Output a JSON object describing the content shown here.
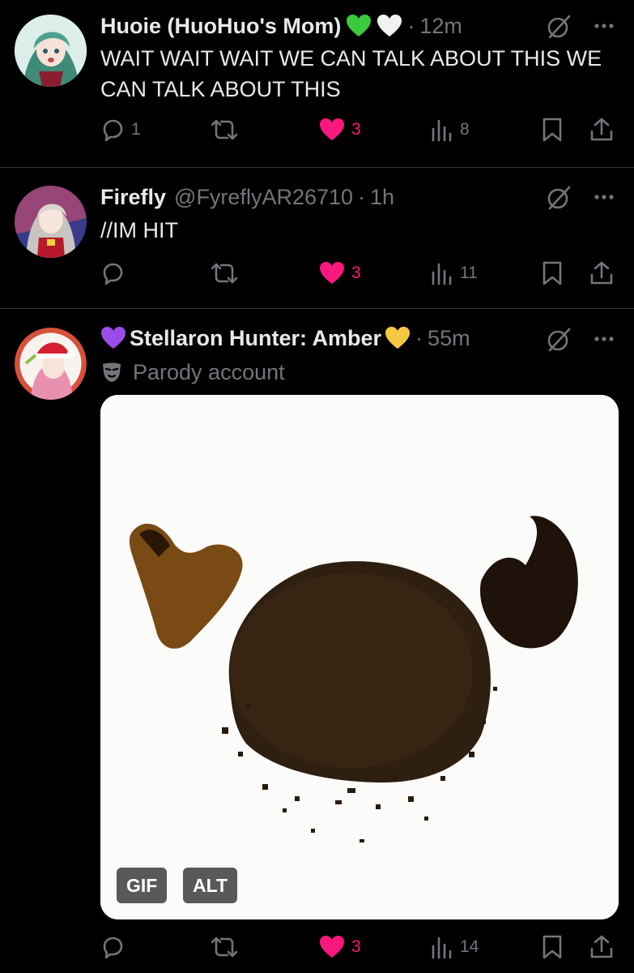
{
  "posts": [
    {
      "display_name": "Huoie (HuoHuo's Mom)",
      "handle": "",
      "time": "12m",
      "text": "WAIT WAIT WAIT WE CAN TALK ABOUT THIS WE CAN TALK ABOUT THIS",
      "name_emojis": [
        "green-heart",
        "white-heart"
      ],
      "replies": "1",
      "likes": "3",
      "views": "8"
    },
    {
      "display_name": "Firefly",
      "handle": "@FyreflyAR26710",
      "time": "1h",
      "text": "//IM HIT",
      "likes": "3",
      "views": "11"
    },
    {
      "display_name": "Stellaron Hunter: Amber",
      "time": "55m",
      "name_emojis": [
        "purple-heart",
        "yellow-heart"
      ],
      "parody_label": "Parody account",
      "media": {
        "badge_gif": "GIF",
        "badge_alt": "ALT"
      },
      "likes": "3",
      "views": "14"
    }
  ],
  "colors": {
    "background": "#000000",
    "text": "#e7e9ea",
    "muted": "#71767b",
    "like": "#f91880",
    "divider": "#2f3336"
  }
}
